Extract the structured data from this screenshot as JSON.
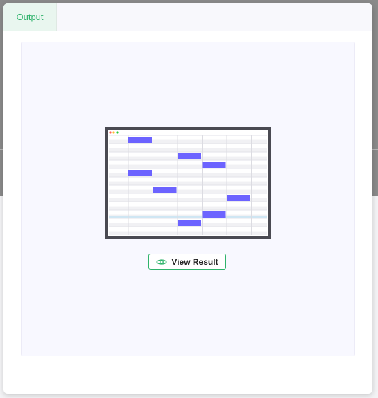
{
  "modal": {
    "tabs": [
      {
        "label": "Output"
      }
    ]
  },
  "output": {
    "view_result_label": "View Result",
    "eye_icon": "eye-icon"
  },
  "thumbnail": {
    "window_dots": [
      "#ff5f56",
      "#ffbd2e",
      "#27c93f"
    ],
    "frame_color": "#4a4a52",
    "cell_color": "#6c63ff",
    "highlight_row_color": "#cfe6f3",
    "grid": {
      "columns": 6,
      "rows": 12,
      "filled_cells": [
        {
          "row": 0,
          "col": 1
        },
        {
          "row": 2,
          "col": 3
        },
        {
          "row": 3,
          "col": 4
        },
        {
          "row": 4,
          "col": 1
        },
        {
          "row": 6,
          "col": 2
        },
        {
          "row": 7,
          "col": 5
        },
        {
          "row": 9,
          "col": 4
        },
        {
          "row": 10,
          "col": 3
        }
      ],
      "highlight_row": 10
    }
  },
  "accent_color": "#2fb36b"
}
